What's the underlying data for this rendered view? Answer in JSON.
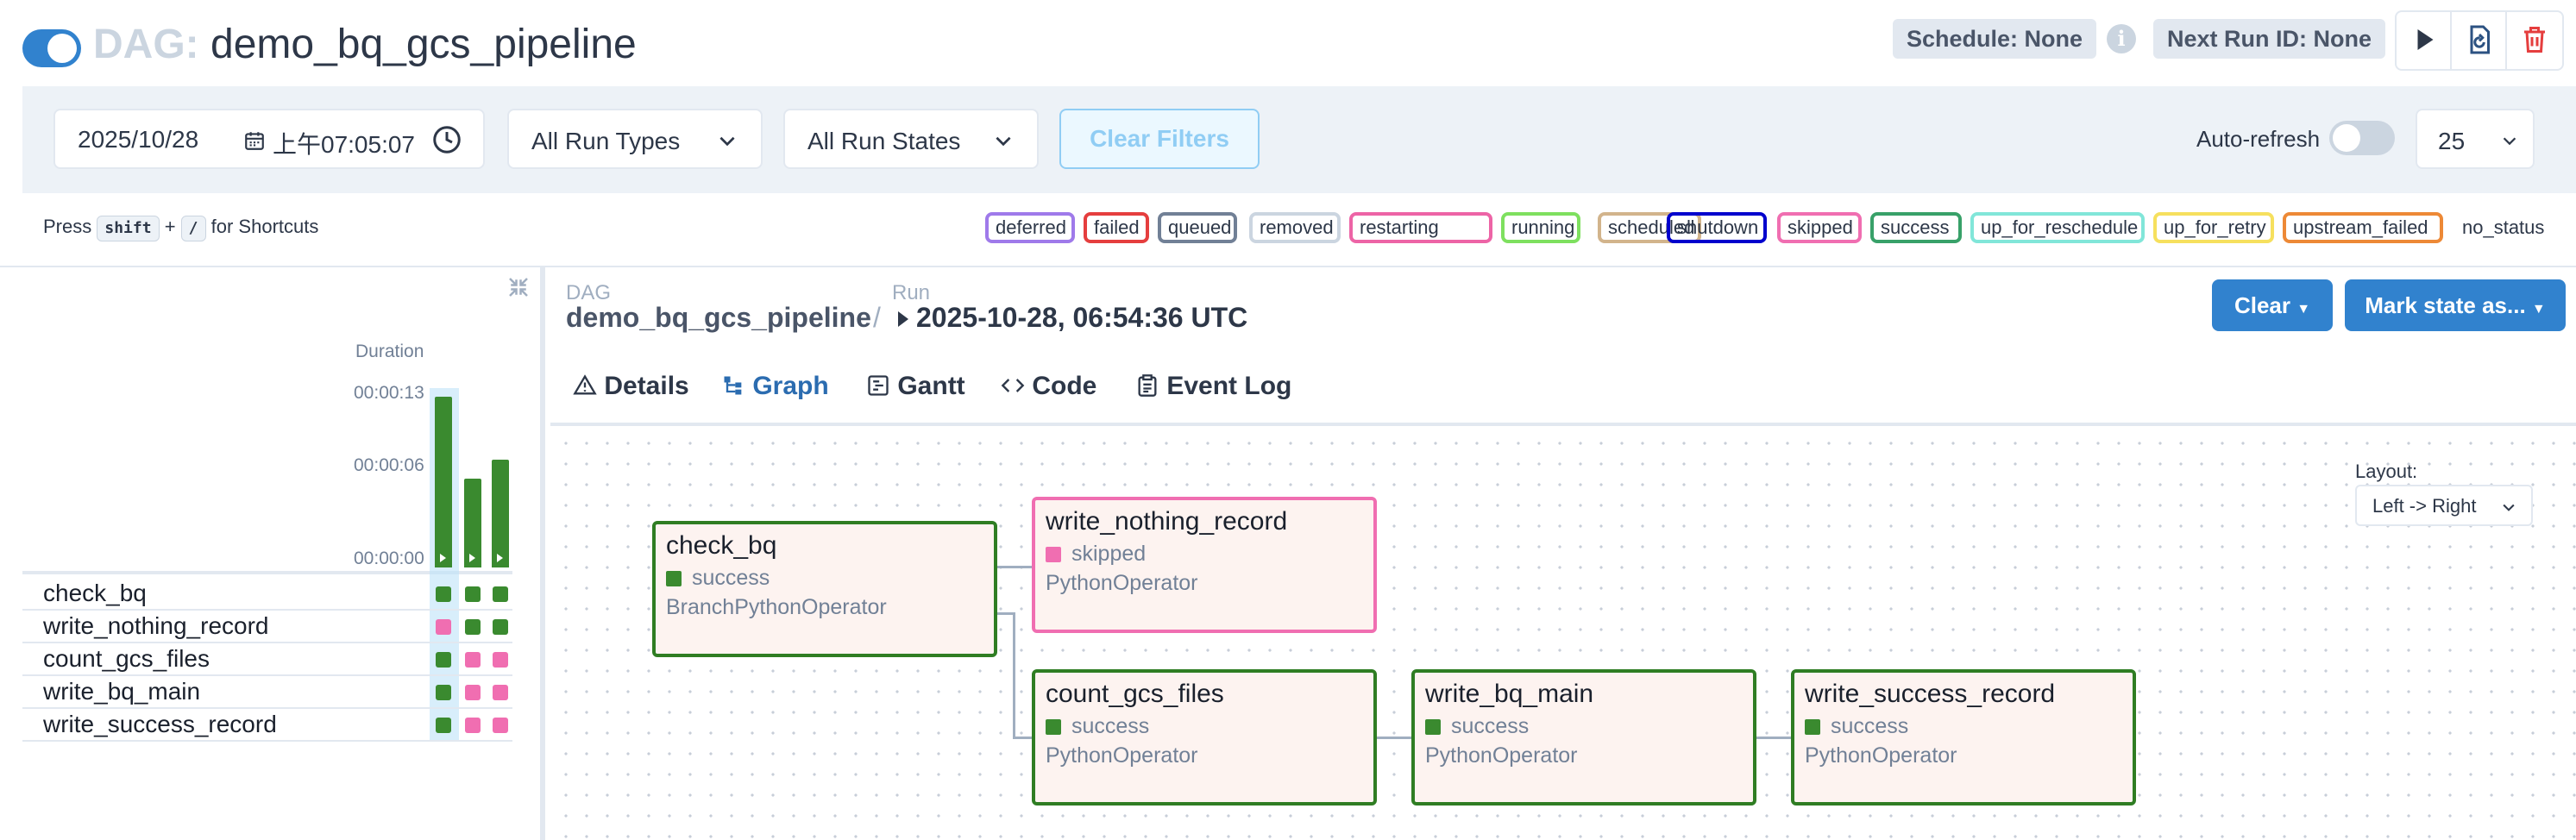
{
  "header": {
    "dag_prefix": "DAG:",
    "dag_name": "demo_bq_gcs_pipeline",
    "schedule": "Schedule: None",
    "next_run": "Next Run ID: None",
    "info_glyph": "i",
    "paused": false
  },
  "filters": {
    "date": "2025/10/28",
    "time": "上午07:05:07",
    "run_types": "All Run Types",
    "run_states": "All Run States",
    "clear_filters": "Clear Filters",
    "auto_refresh_label": "Auto-refresh",
    "auto_refresh": false,
    "num_runs": "25"
  },
  "shortcuts": {
    "press": "Press",
    "key1": "shift",
    "plus": "+",
    "key2": "/",
    "suffix": "for Shortcuts"
  },
  "legend": [
    {
      "label": "deferred",
      "color": "#9f7aea"
    },
    {
      "label": "failed",
      "color": "#e53e3e"
    },
    {
      "label": "queued",
      "color": "#718096"
    },
    {
      "label": "removed",
      "color": "#cbd5e0"
    },
    {
      "label": "restarting",
      "color": "#ed64a6"
    },
    {
      "label": "running",
      "color": "#7ee05f"
    },
    {
      "label": "scheduled",
      "color": "#d2b48c"
    },
    {
      "label": "shutdown",
      "color": "#0000cd"
    },
    {
      "label": "skipped",
      "color": "#f06eb1"
    },
    {
      "label": "success",
      "color": "#38a169"
    },
    {
      "label": "up_for_reschedule",
      "color": "#81e6d9"
    },
    {
      "label": "up_for_retry",
      "color": "#f6e05e"
    },
    {
      "label": "upstream_failed",
      "color": "#ed8936"
    },
    {
      "label": "no_status",
      "color": "none"
    }
  ],
  "grid": {
    "duration_label": "Duration",
    "duration_ticks": [
      "00:00:13",
      "00:00:06",
      "00:00:00"
    ],
    "runs": [
      {
        "duration_fraction": 1.0,
        "selected": true
      },
      {
        "duration_fraction": 0.52,
        "selected": false
      },
      {
        "duration_fraction": 0.63,
        "selected": false
      }
    ],
    "tasks": [
      {
        "name": "check_bq",
        "states": [
          "success",
          "success",
          "success"
        ]
      },
      {
        "name": "write_nothing_record",
        "states": [
          "skipped",
          "success",
          "success"
        ]
      },
      {
        "name": "count_gcs_files",
        "states": [
          "success",
          "skipped",
          "skipped"
        ]
      },
      {
        "name": "write_bq_main",
        "states": [
          "success",
          "skipped",
          "skipped"
        ]
      },
      {
        "name": "write_success_record",
        "states": [
          "success",
          "skipped",
          "skipped"
        ]
      }
    ],
    "state_colors": {
      "success": "#3a8a2f",
      "skipped": "#f06eb1"
    }
  },
  "details": {
    "dag_label": "DAG",
    "dag_value": "demo_bq_gcs_pipeline",
    "separator": "/",
    "run_label": "Run",
    "run_value": "2025-10-28, 06:54:36 UTC",
    "clear_button": "Clear",
    "mark_state_button": "Mark state as...",
    "tabs": [
      "Details",
      "Graph",
      "Gantt",
      "Code",
      "Event Log"
    ],
    "active_tab": "Graph"
  },
  "graph": {
    "layout_label": "Layout:",
    "layout_value": "Left -> Right",
    "nodes": [
      {
        "name": "check_bq",
        "state": "success",
        "operator": "BranchPythonOperator"
      },
      {
        "name": "write_nothing_record",
        "state": "skipped",
        "operator": "PythonOperator"
      },
      {
        "name": "count_gcs_files",
        "state": "success",
        "operator": "PythonOperator"
      },
      {
        "name": "write_bq_main",
        "state": "success",
        "operator": "PythonOperator"
      },
      {
        "name": "write_success_record",
        "state": "success",
        "operator": "PythonOperator"
      }
    ]
  }
}
